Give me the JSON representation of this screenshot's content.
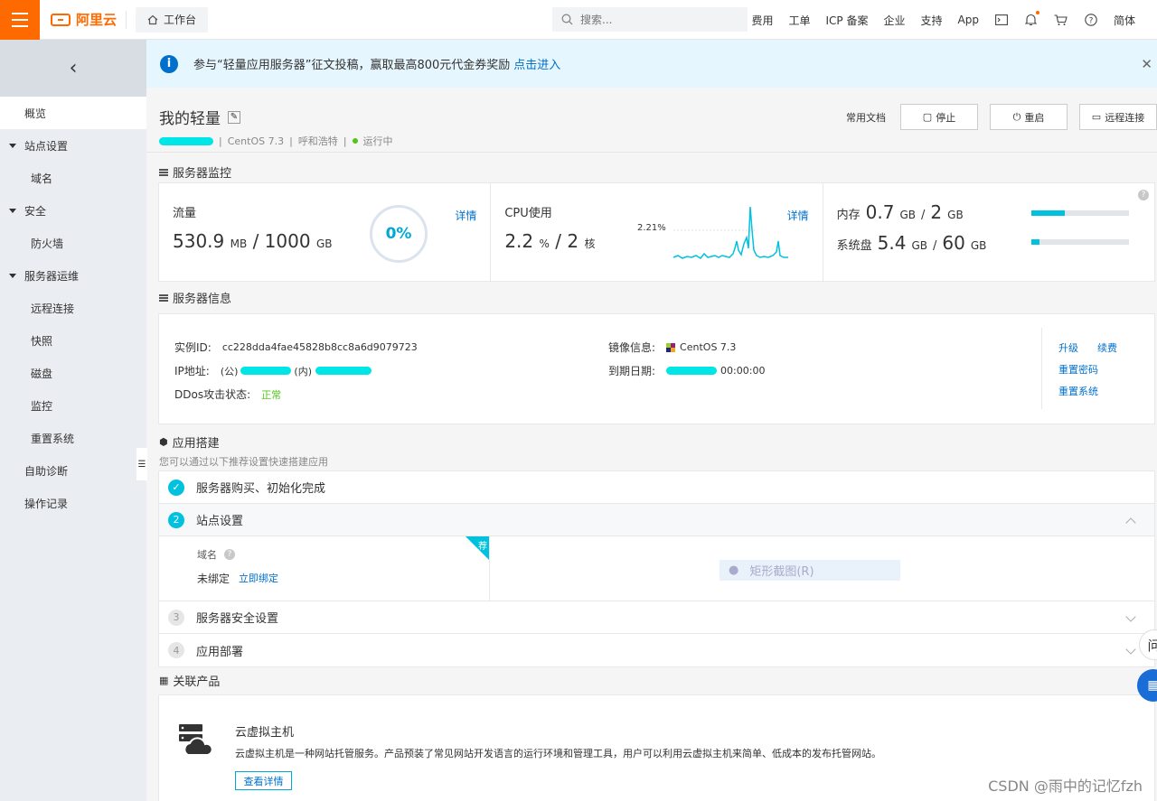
{
  "topbar": {
    "logo": "阿里云",
    "workbench": "工作台",
    "search_placeholder": "搜索...",
    "nav": [
      "费用",
      "工单",
      "ICP 备案",
      "企业",
      "支持",
      "App"
    ],
    "lang": "简体"
  },
  "sidebar": {
    "items": [
      {
        "label": "概览",
        "type": "active"
      },
      {
        "label": "站点设置",
        "type": "group"
      },
      {
        "label": "域名",
        "type": "sub"
      },
      {
        "label": "安全",
        "type": "group"
      },
      {
        "label": "防火墙",
        "type": "sub"
      },
      {
        "label": "服务器运维",
        "type": "group"
      },
      {
        "label": "远程连接",
        "type": "sub"
      },
      {
        "label": "快照",
        "type": "sub"
      },
      {
        "label": "磁盘",
        "type": "sub"
      },
      {
        "label": "监控",
        "type": "sub"
      },
      {
        "label": "重置系统",
        "type": "sub"
      },
      {
        "label": "自助诊断",
        "type": "item"
      },
      {
        "label": "操作记录",
        "type": "item"
      }
    ]
  },
  "notice": {
    "text": "参与“轻量应用服务器”征文投稿，赢取最高800元代金券奖励",
    "link": "点击进入"
  },
  "server": {
    "name": "我的轻量",
    "os": "CentOS 7.3",
    "region": "呼和浩特",
    "status": "运行中",
    "doc": "常用文档",
    "stop": "停止",
    "restart": "重启",
    "remote": "远程连接"
  },
  "monitor": {
    "title": "服务器监控",
    "traffic": {
      "label": "流量",
      "used": "530.9",
      "used_unit": "MB",
      "total": "1000",
      "total_unit": "GB",
      "percent": "0%",
      "percent_value": 0,
      "detail": "详情"
    },
    "cpu": {
      "label": "CPU使用",
      "used": "2.2",
      "used_unit": "%",
      "cores": "2",
      "cores_unit": "核",
      "peak": "2.21%",
      "detail": "详情"
    },
    "memory": {
      "label": "内存",
      "used": "0.7",
      "used_unit": "GB",
      "total": "2",
      "total_unit": "GB",
      "fill": 0.35
    },
    "disk": {
      "label": "系统盘",
      "used": "5.4",
      "used_unit": "GB",
      "total": "60",
      "total_unit": "GB",
      "fill": 0.09
    }
  },
  "info": {
    "title": "服务器信息",
    "instance_label": "实例ID:",
    "instance_id": "cc228dda4fae45828b8cc8a6d9079723",
    "ip_label": "IP地址:",
    "ip_public_prefix": "(公)",
    "ip_private_prefix": "(内)",
    "ddos_label": "DDos攻击状态:",
    "ddos_value": "正常",
    "image_label": "镜像信息:",
    "image_value": "CentOS 7.3",
    "expire_label": "到期日期:",
    "expire_value": "00:00:00",
    "links": [
      "升级",
      "续费",
      "重置密码",
      "重置系统"
    ]
  },
  "app": {
    "title": "应用搭建",
    "tip": "您可以通过以下推荐设置快速搭建应用",
    "steps": [
      {
        "num": "✓",
        "label": "服务器购买、初始化完成"
      },
      {
        "num": "2",
        "label": "站点设置"
      },
      {
        "num": "3",
        "label": "服务器安全设置"
      },
      {
        "num": "4",
        "label": "应用部署"
      }
    ],
    "domain_label": "域名",
    "domain_status": "未绑定",
    "domain_bind": "立即绑定",
    "badge": "荐",
    "overlay": "矩形截图(R)"
  },
  "products": {
    "title": "关联产品",
    "name": "云虚拟主机",
    "desc": "云虚拟主机是一种网站托管服务。产品预装了常见网站开发语言的运行环境和管理工具，用户可以利用云虚拟主机来简单、低成本的发布托管网站。",
    "button": "查看详情"
  },
  "watermark": "CSDN @雨中的记忆fzh",
  "float_char": "问",
  "colors": {
    "accent": "#ff6a00",
    "primary": "#0070cc",
    "cyan": "#00c1de"
  }
}
